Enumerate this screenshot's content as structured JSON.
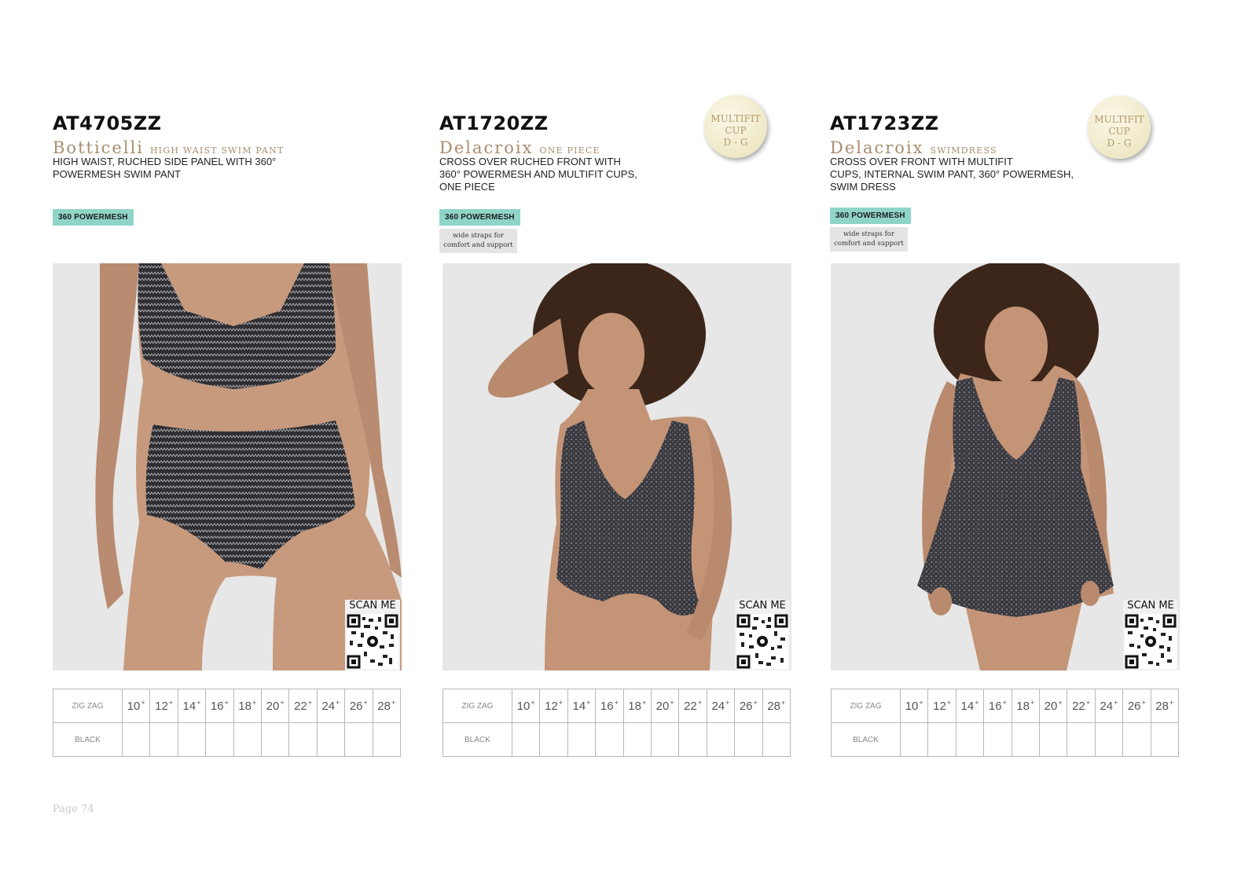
{
  "page": {
    "label": "Page 74"
  },
  "colors": {
    "feature_tag": "#8fd5c7",
    "name_gold": "#a88d6e",
    "photo_bg": "#e7e7e7"
  },
  "products": [
    {
      "code": "AT4705ZZ",
      "name": "Botticelli",
      "type": "HIGH WAIST SWIM PANT",
      "description": [
        "HIGH WAIST, RUCHED SIDE PANEL WITH 360°",
        "POWERMESH SWIM PANT"
      ],
      "feature_tag": "360 POWERMESH",
      "scan_label": "SCAN ME",
      "photo_icon": "model-high-waist-swim-pant-photo",
      "sizes": [
        "10",
        "12",
        "14",
        "16",
        "18",
        "20",
        "22",
        "24",
        "26",
        "28"
      ],
      "size_suffix": "+",
      "colors_rows": [
        "ZIG ZAG",
        "BLACK"
      ]
    },
    {
      "code": "AT1720ZZ",
      "name": "Delacroix",
      "type": "ONE PIECE",
      "description": [
        "CROSS OVER RUCHED FRONT WITH",
        "360° POWERMESH AND MULTIFIT CUPS,",
        "ONE PIECE"
      ],
      "feature_tag": "360 POWERMESH",
      "note_tag": [
        "wide straps for",
        "comfort and support"
      ],
      "badge": [
        "MULTIFIT",
        "CUP",
        "D - G"
      ],
      "scan_label": "SCAN ME",
      "photo_icon": "model-one-piece-photo",
      "sizes": [
        "10",
        "12",
        "14",
        "16",
        "18",
        "20",
        "22",
        "24",
        "26",
        "28"
      ],
      "size_suffix": "+",
      "colors_rows": [
        "ZIG ZAG",
        "BLACK"
      ]
    },
    {
      "code": "AT1723ZZ",
      "name": "Delacroix",
      "type": "SWIMDRESS",
      "description": [
        "CROSS OVER FRONT WITH MULTIFIT",
        "CUPS, INTERNAL SWIM PANT, 360° POWERMESH,",
        "SWIM DRESS"
      ],
      "feature_tag": "360 POWERMESH",
      "note_tag": [
        "wide straps for",
        "comfort and support"
      ],
      "badge": [
        "MULTIFIT",
        "CUP",
        "D - G"
      ],
      "scan_label": "SCAN ME",
      "photo_icon": "model-swimdress-photo",
      "sizes": [
        "10",
        "12",
        "14",
        "16",
        "18",
        "20",
        "22",
        "24",
        "26",
        "28"
      ],
      "size_suffix": "+",
      "colors_rows": [
        "ZIG ZAG",
        "BLACK"
      ]
    }
  ]
}
